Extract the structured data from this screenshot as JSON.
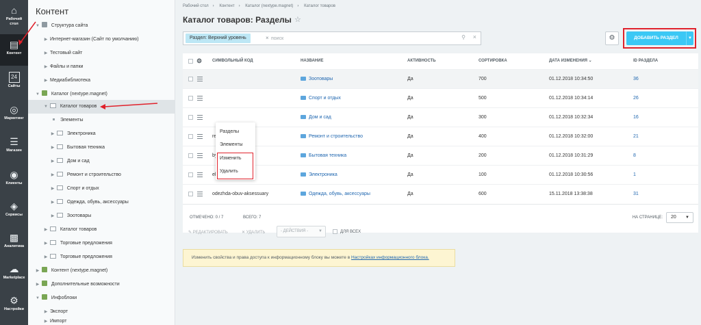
{
  "iconbar": {
    "items": [
      {
        "label_line1": "Рабочий",
        "label_line2": "стол",
        "icon": "home-icon"
      },
      {
        "label_line1": "Контент",
        "label_line2": "",
        "icon": "document-icon",
        "active": true
      },
      {
        "label_line1": "24",
        "label_line2": "Сайты",
        "icon": "calendar-icon"
      },
      {
        "label_line1": "Маркетинг",
        "label_line2": "",
        "icon": "target-icon"
      },
      {
        "label_line1": "Магазин",
        "label_line2": "",
        "icon": "cart-icon"
      },
      {
        "label_line1": "Клиенты",
        "label_line2": "",
        "icon": "clients-icon"
      },
      {
        "label_line1": "Сервисы",
        "label_line2": "",
        "icon": "layers-icon"
      },
      {
        "label_line1": "Аналитика",
        "label_line2": "",
        "icon": "chart-icon"
      },
      {
        "label_line1": "Marketplace",
        "label_line2": "",
        "icon": "cloud-icon"
      },
      {
        "label_line1": "Настройки",
        "label_line2": "",
        "icon": "gear-icon"
      }
    ]
  },
  "tree": {
    "title": "Контент",
    "items": [
      {
        "label": "Структура сайта"
      },
      {
        "label": "Интернет-магазин (Сайт по умолчанию)"
      },
      {
        "label": "Тестовый сайт"
      },
      {
        "label": "Файлы и папки"
      },
      {
        "label": "Медиабиблиотека"
      },
      {
        "label": "Каталог (nextype.magnet)"
      },
      {
        "label": "Каталог товаров"
      },
      {
        "label": "Элементы"
      },
      {
        "label": "Электроника"
      },
      {
        "label": "Бытовая техника"
      },
      {
        "label": "Дом и сад"
      },
      {
        "label": "Ремонт и строительство"
      },
      {
        "label": "Спорт и отдых"
      },
      {
        "label": "Одежда, обувь, аксессуары"
      },
      {
        "label": "Зоотовары"
      },
      {
        "label": "Каталог товаров"
      },
      {
        "label": "Торговые предложения"
      },
      {
        "label": "Торговые предложения"
      },
      {
        "label": "Контент (nextype.magnet)"
      },
      {
        "label": "Дополнительные возможности"
      },
      {
        "label": "Инфоблоки"
      },
      {
        "label": "Экспорт"
      },
      {
        "label": "Импорт"
      }
    ]
  },
  "breadcrumbs": [
    "Рабочий стол",
    "Контент",
    "Каталог (nextype.magnet)",
    "Каталог товаров"
  ],
  "page_title": "Каталог товаров: Разделы",
  "filter": {
    "chip": "Раздел: Верхний уровень",
    "placeholder": "поиск"
  },
  "toolbar": {
    "add_label": "ДОБАВИТЬ РАЗДЕЛ"
  },
  "table": {
    "headers": {
      "code": "СИМВОЛЬНЫЙ КОД",
      "name": "НАЗВАНИЕ",
      "active": "АКТИВНОСТЬ",
      "sort": "СОРТИРОВКА",
      "date": "ДАТА ИЗМЕНЕНИЯ",
      "date_sort_icon": "chevron-down-icon",
      "id": "ID РАЗДЕЛА"
    },
    "rows": [
      {
        "code": "",
        "name": "Зоотовары",
        "active": "Да",
        "sort": "700",
        "date": "01.12.2018 10:34:50",
        "id": "36"
      },
      {
        "code": "",
        "name": "Спорт и отдых",
        "active": "Да",
        "sort": "500",
        "date": "01.12.2018 10:34:14",
        "id": "26"
      },
      {
        "code": "",
        "name": "Дом и сад",
        "active": "Да",
        "sort": "300",
        "date": "01.12.2018 10:32:34",
        "id": "16"
      },
      {
        "code": "remont-i-stroitelstvo",
        "name": "Ремонт и строительство",
        "active": "Да",
        "sort": "400",
        "date": "01.12.2018 10:32:00",
        "id": "21"
      },
      {
        "code": "bytovaya-tekhnika",
        "name": "Бытовая техника",
        "active": "Да",
        "sort": "200",
        "date": "01.12.2018 10:31:29",
        "id": "8"
      },
      {
        "code": "elektronika",
        "name": "Электроника",
        "active": "Да",
        "sort": "100",
        "date": "01.12.2018 10:30:56",
        "id": "1"
      },
      {
        "code": "odezhda-obuv-aksessuary",
        "name": "Одежда, обувь, аксессуары",
        "active": "Да",
        "sort": "600",
        "date": "15.11.2018 13:38:38",
        "id": "31"
      }
    ],
    "footer": {
      "marked": "ОТМЕЧЕНО: 0 / 7",
      "total": "ВСЕГО: 7",
      "per_page_label": "НА СТРАНИЦЕ:",
      "per_page_value": "20"
    }
  },
  "context_menu": {
    "items": [
      "Разделы",
      "Элементы",
      "Изменить",
      "Удалить"
    ]
  },
  "actions": {
    "edit": "РЕДАКТИРОВАТЬ",
    "delete": "УДАЛИТЬ",
    "select": "- ДЕЙСТВИЯ -",
    "for_all": "ДЛЯ ВСЕХ"
  },
  "info": {
    "text": "Изменить свойства и права доступа к информационному блоку вы можете в ",
    "link": "Настройках информационного блока."
  },
  "colors": {
    "accent": "#3bc8f5",
    "annotation": "#e0212b",
    "link": "#2067b0"
  }
}
